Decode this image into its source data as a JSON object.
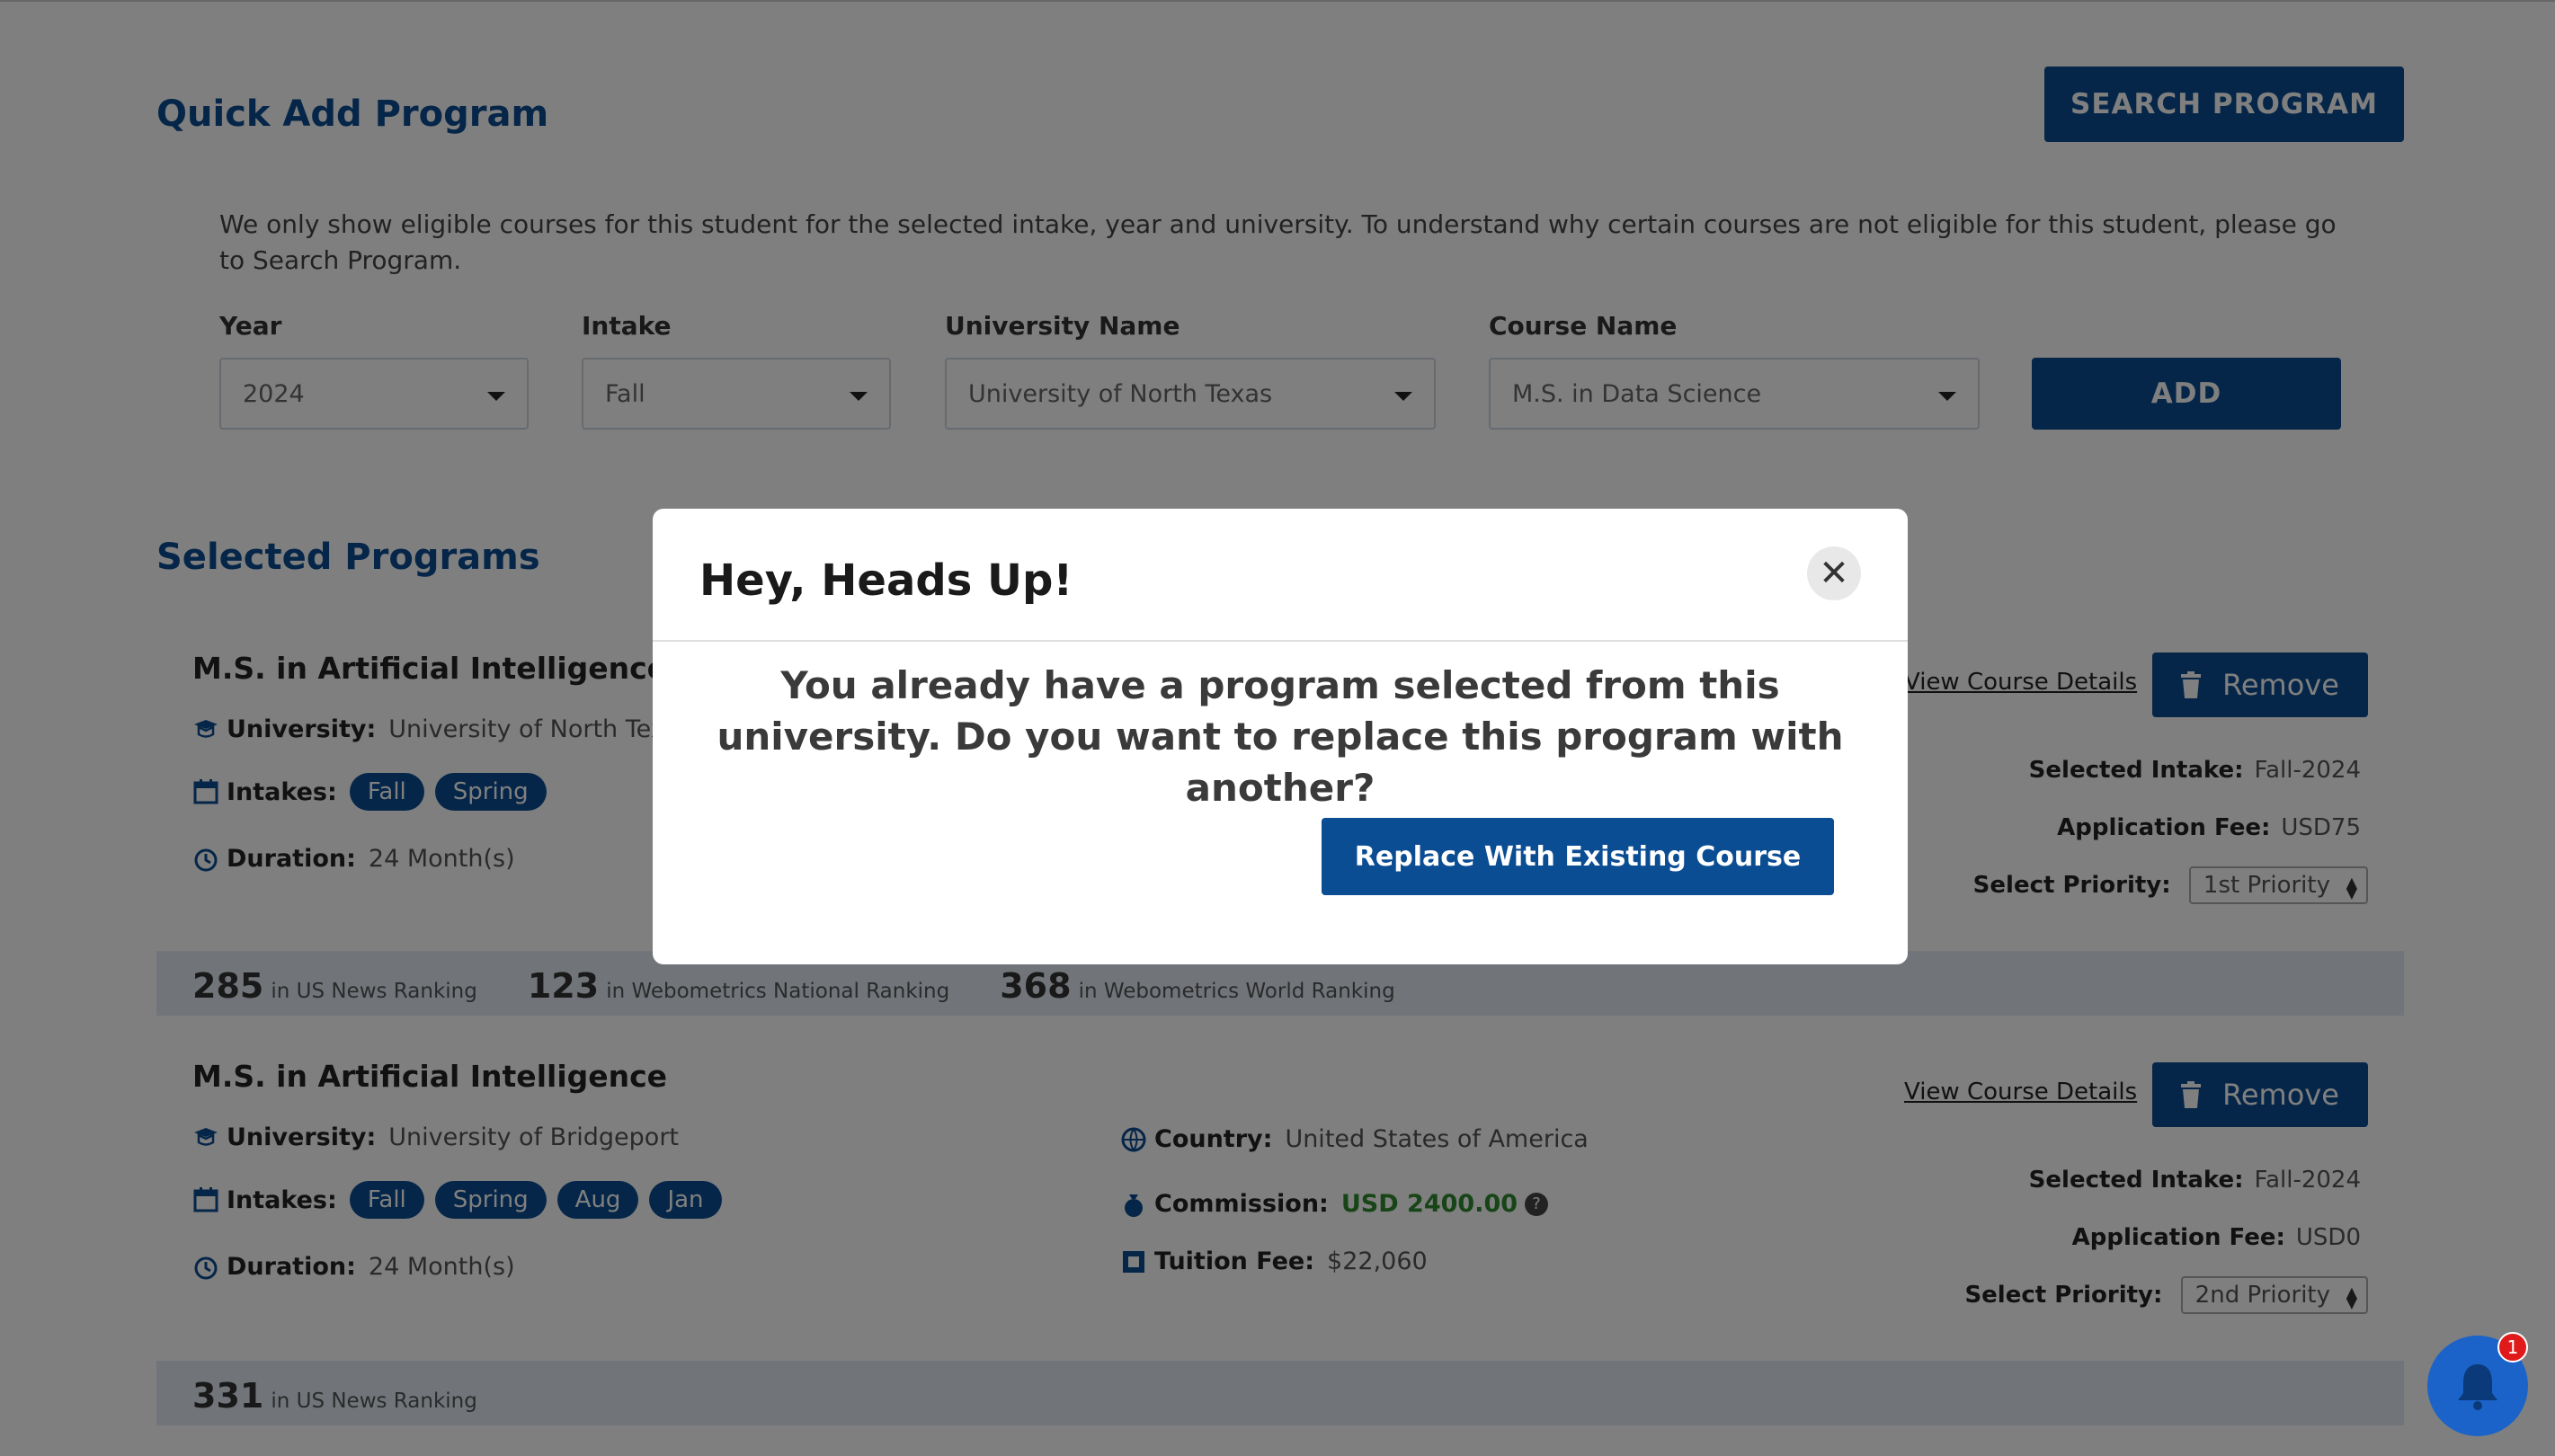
{
  "quick_add": {
    "title": "Quick Add Program",
    "search_button": "SEARCH PROGRAM",
    "info": "We only show eligible courses for this student for the selected intake, year and university. To understand why certain courses are not eligible for this student, please go to Search Program.",
    "year_label": "Year",
    "year_value": "2024",
    "intake_label": "Intake",
    "intake_value": "Fall",
    "university_label": "University Name",
    "university_value": "University of North Texas",
    "course_label": "Course Name",
    "course_value": "M.S. in Data Science",
    "add_button": "ADD"
  },
  "selected": {
    "title": "Selected Programs",
    "programs": [
      {
        "name": "M.S. in Artificial Intelligence",
        "university_label": "University:",
        "university": "University of North Texas",
        "intakes_label": "Intakes:",
        "intakes": [
          "Fall",
          "Spring"
        ],
        "duration_label": "Duration:",
        "duration": "24 Month(s)",
        "view_details": "View Course Details",
        "remove": "Remove",
        "selected_intake_label": "Selected Intake:",
        "selected_intake": "Fall-2024",
        "app_fee_label": "Application Fee:",
        "app_fee": "USD75",
        "priority_label": "Select Priority:",
        "priority": "1st Priority",
        "rankings": [
          {
            "num": "285",
            "label": "in US News Ranking"
          },
          {
            "num": "123",
            "label": "in Webometrics National Ranking"
          },
          {
            "num": "368",
            "label": "in Webometrics World Ranking"
          }
        ]
      },
      {
        "name": "M.S. in Artificial Intelligence",
        "university_label": "University:",
        "university": "University of Bridgeport",
        "intakes_label": "Intakes:",
        "intakes": [
          "Fall",
          "Spring",
          "Aug",
          "Jan"
        ],
        "duration_label": "Duration:",
        "duration": "24 Month(s)",
        "country_label": "Country:",
        "country": "United States of America",
        "commission_label": "Commission:",
        "commission": "USD 2400.00",
        "tuition_label": "Tuition Fee:",
        "tuition": "$22,060",
        "view_details": "View Course Details",
        "remove": "Remove",
        "selected_intake_label": "Selected Intake:",
        "selected_intake": "Fall-2024",
        "app_fee_label": "Application Fee:",
        "app_fee": "USD0",
        "priority_label": "Select Priority:",
        "priority": "2nd Priority",
        "rankings": [
          {
            "num": "331",
            "label": "in US News Ranking"
          }
        ]
      }
    ]
  },
  "modal": {
    "title": "Hey, Heads Up!",
    "close_glyph": "✕",
    "message": "You already have a program selected from this university. Do you want to replace this program with another?",
    "button": "Replace With Existing Course"
  },
  "notifications": {
    "count": "1"
  },
  "colors": {
    "brand": "#0b4d93",
    "commission": "#2e8b2e",
    "overlay": "rgba(0,0,0,0.5)"
  }
}
